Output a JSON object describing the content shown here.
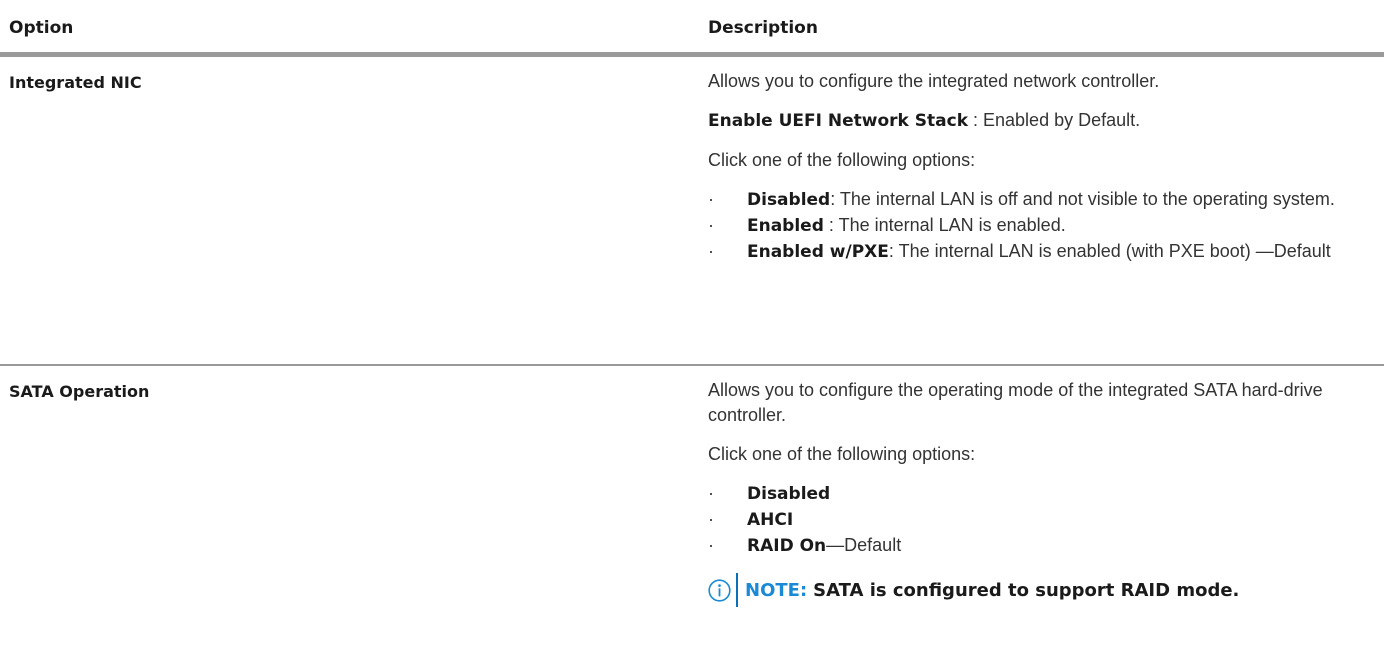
{
  "table": {
    "headers": {
      "option": "Option",
      "description": "Description"
    },
    "rows": [
      {
        "option": "Integrated NIC",
        "intro": "Allows you to configure the integrated network controller.",
        "stack_label": "Enable UEFI Network Stack",
        "stack_text": " : Enabled by Default.",
        "prompt": "Click one of the following options:",
        "options": [
          {
            "bullet": "·",
            "name": "Disabled",
            "text": ": The internal LAN is off and not visible to the operating system."
          },
          {
            "bullet": "·",
            "name": "Enabled",
            "text": " : The internal LAN is enabled."
          },
          {
            "bullet": "·",
            "name": "Enabled w/PXE",
            "text": ": The internal LAN is enabled (with PXE boot) —Default"
          }
        ]
      },
      {
        "option": "SATA Operation",
        "intro": "Allows you to configure the operating mode of the integrated SATA hard-drive controller.",
        "prompt": "Click one of the following options:",
        "options": [
          {
            "bullet": "·",
            "name": "Disabled",
            "text": ""
          },
          {
            "bullet": "·",
            "name": "AHCI",
            "text": ""
          },
          {
            "bullet": "·",
            "name": "RAID On",
            "text": "—Default"
          }
        ],
        "note": {
          "icon": "info-icon",
          "label": "NOTE:",
          "text": "SATA is configured to support RAID mode.",
          "accent_color": "#1a8ad6"
        }
      }
    ]
  }
}
